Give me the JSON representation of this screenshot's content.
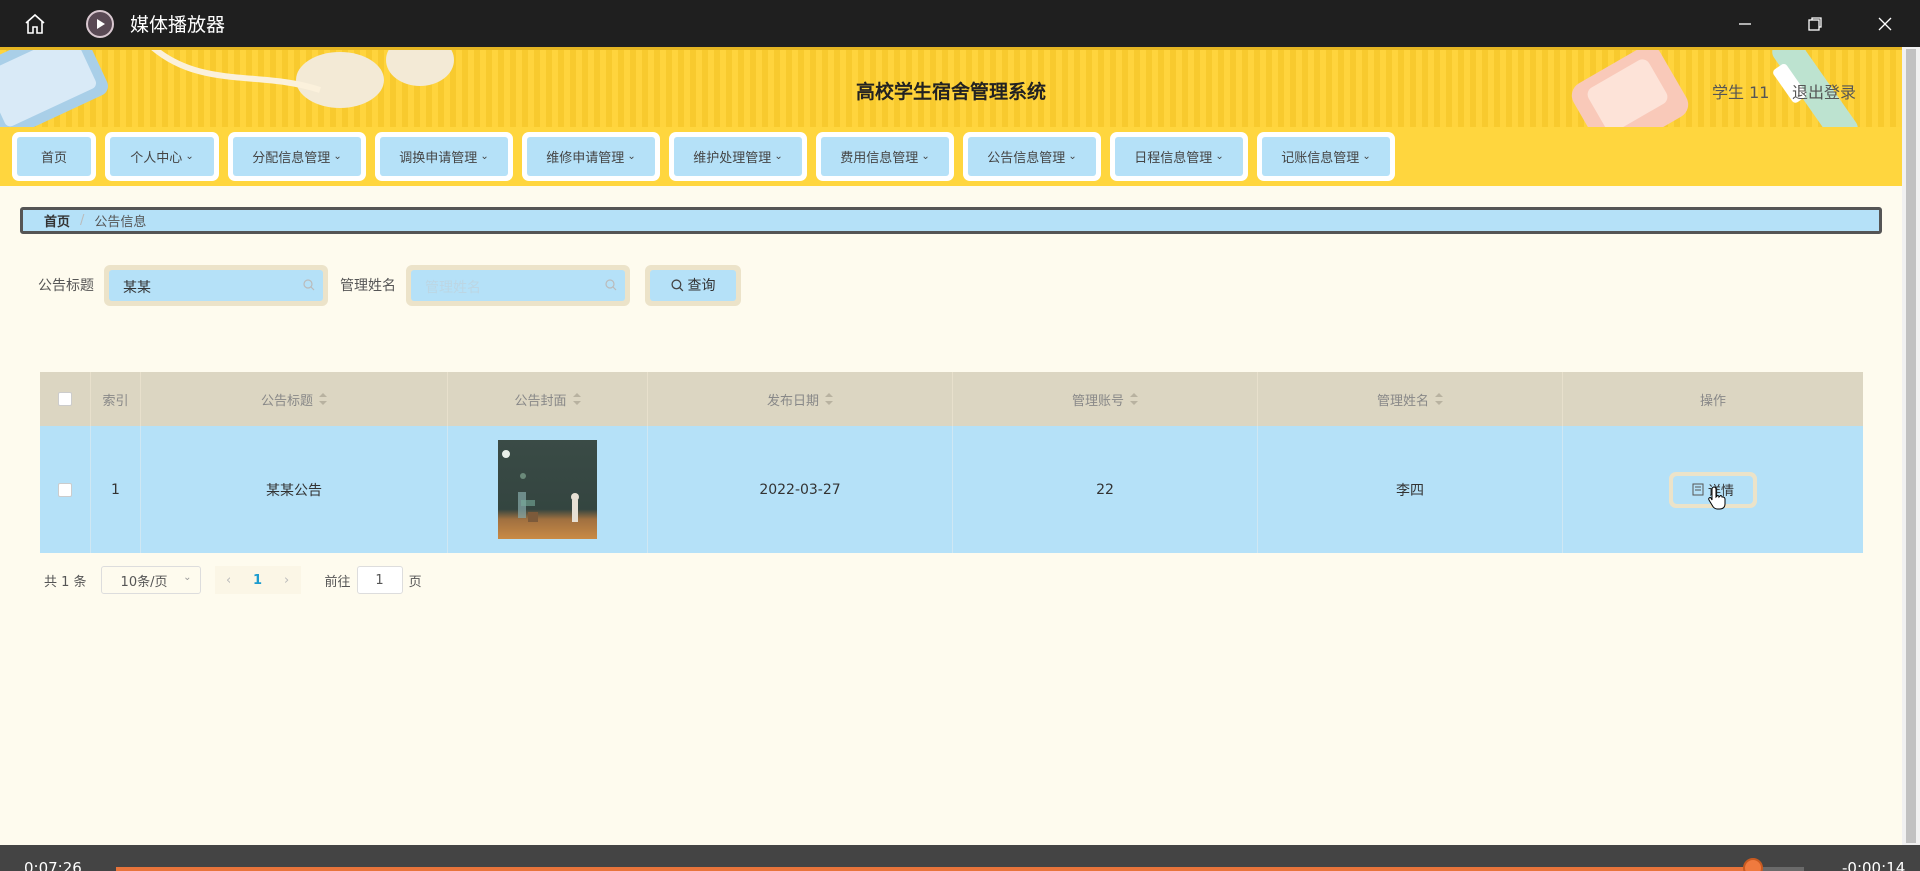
{
  "window": {
    "title": "媒体播放器"
  },
  "header": {
    "title": "高校学生宿舍管理系统",
    "user": "学生 11",
    "logout": "退出登录"
  },
  "nav": {
    "items": [
      {
        "label": "首页",
        "dropdown": false
      },
      {
        "label": "个人中心",
        "dropdown": true
      },
      {
        "label": "分配信息管理",
        "dropdown": true
      },
      {
        "label": "调换申请管理",
        "dropdown": true
      },
      {
        "label": "维修申请管理",
        "dropdown": true
      },
      {
        "label": "维护处理管理",
        "dropdown": true
      },
      {
        "label": "费用信息管理",
        "dropdown": true
      },
      {
        "label": "公告信息管理",
        "dropdown": true
      },
      {
        "label": "日程信息管理",
        "dropdown": true
      },
      {
        "label": "记账信息管理",
        "dropdown": true
      }
    ]
  },
  "breadcrumb": {
    "home": "首页",
    "separator": "/",
    "current": "公告信息"
  },
  "search": {
    "title_label": "公告标题",
    "title_value": "某某",
    "name_label": "管理姓名",
    "name_placeholder": "管理姓名",
    "query_label": "查询"
  },
  "table": {
    "headers": {
      "index": "索引",
      "title": "公告标题",
      "cover": "公告封面",
      "date": "发布日期",
      "account": "管理账号",
      "name": "管理姓名",
      "actions": "操作"
    },
    "rows": [
      {
        "index": "1",
        "title": "某某公告",
        "date": "2022-03-27",
        "account": "22",
        "name": "李四",
        "action": "详情"
      }
    ]
  },
  "pagination": {
    "total": "共 1 条",
    "page_size": "10条/页",
    "current_page": "1",
    "goto_label": "前往",
    "goto_value": "1",
    "page_suffix": "页"
  },
  "media": {
    "elapsed": "0:07:26",
    "remaining": "-0:00:14",
    "progress": 0.97
  },
  "colors": {
    "banner_yellow": "#ffd43d",
    "nav_blue": "#b5e1f8",
    "page_bg": "#fefbee",
    "table_header": "#dcd6c2",
    "media_accent": "#e8743b"
  }
}
